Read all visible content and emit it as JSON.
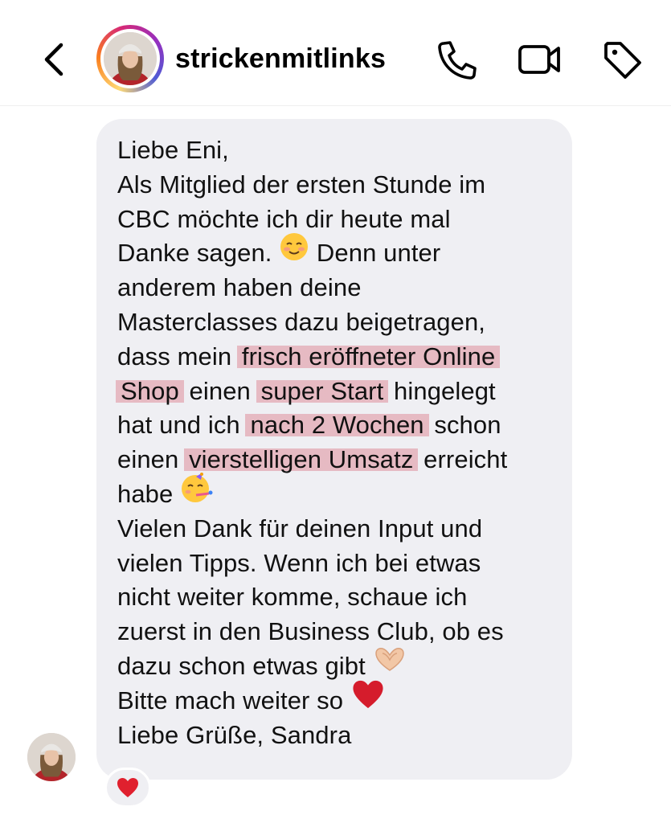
{
  "header": {
    "username": "strickenmitlinks"
  },
  "message": {
    "lines": [
      [
        {
          "t": "Liebe Eni,"
        }
      ],
      [
        {
          "t": "Als Mitglied der ersten Stunde im"
        }
      ],
      [
        {
          "t": "CBC möchte ich dir heute mal"
        }
      ],
      [
        {
          "t": "Danke sagen. "
        },
        {
          "emoji": "smiling-blush-emoji"
        },
        {
          "t": " Denn unter"
        }
      ],
      [
        {
          "t": "anderem haben deine"
        }
      ],
      [
        {
          "t": "Masterclasses dazu beigetragen,"
        }
      ],
      [
        {
          "t": "dass mein "
        },
        {
          "t": "frisch eröffneter Online",
          "h": true
        }
      ],
      [
        {
          "t": "Shop",
          "h": true
        },
        {
          "t": " einen "
        },
        {
          "t": "super Start",
          "h": true
        },
        {
          "t": " hingelegt"
        }
      ],
      [
        {
          "t": "hat und ich "
        },
        {
          "t": "nach 2 Wochen",
          "h": true
        },
        {
          "t": " schon"
        }
      ],
      [
        {
          "t": "einen "
        },
        {
          "t": "vierstelligen Umsatz",
          "h": true
        },
        {
          "t": " erreicht"
        }
      ],
      [
        {
          "t": "habe "
        },
        {
          "emoji": "party-face-emoji"
        }
      ],
      [
        {
          "t": "Vielen Dank für deinen Input und"
        }
      ],
      [
        {
          "t": "vielen Tipps. Wenn ich bei etwas"
        }
      ],
      [
        {
          "t": "nicht weiter komme, schaue ich"
        }
      ],
      [
        {
          "t": "zuerst in den Business Club, ob es"
        }
      ],
      [
        {
          "t": "dazu schon etwas gibt "
        },
        {
          "emoji": "heart-hands-emoji"
        }
      ],
      [
        {
          "t": "Bitte mach weiter so "
        },
        {
          "emoji": "red-heart-emoji"
        }
      ],
      [
        {
          "t": "Liebe Grüße, Sandra"
        }
      ]
    ]
  },
  "reaction": {
    "icon": "red-heart-icon",
    "color": "#e0202e"
  },
  "colors": {
    "highlight": "#e8b4bc",
    "bubble": "#efeff3",
    "story_ring": [
      "#feda75",
      "#fa7e1e",
      "#d62976",
      "#962fbf"
    ]
  }
}
